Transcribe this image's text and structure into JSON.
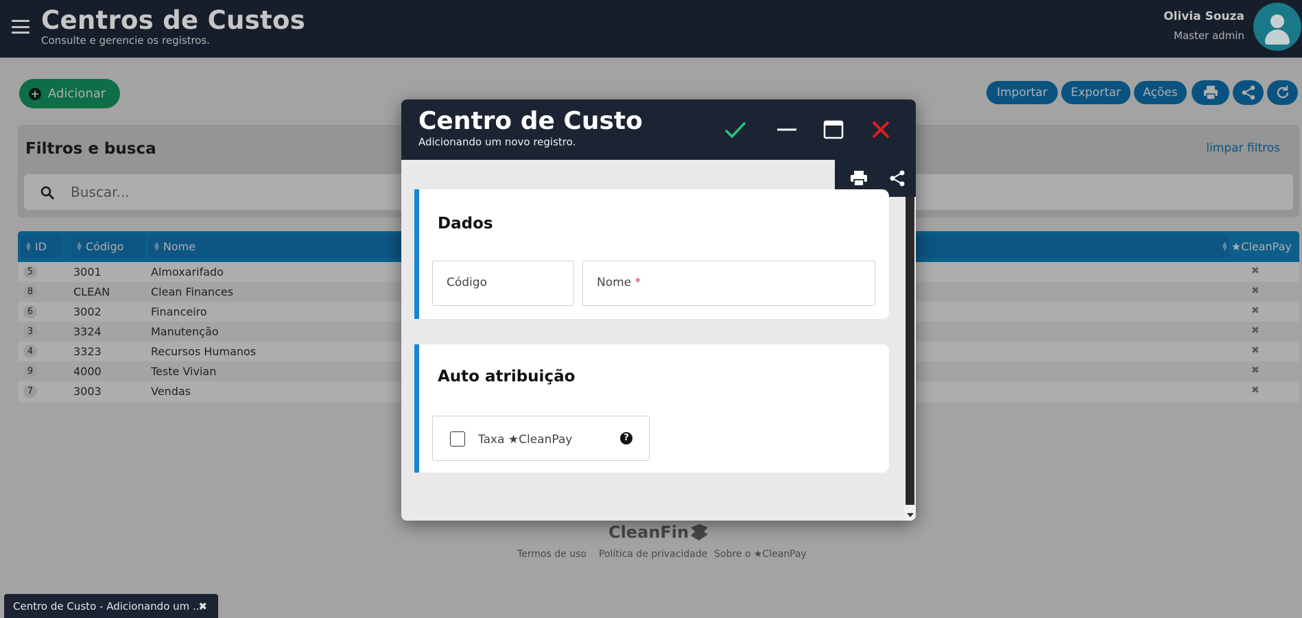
{
  "header": {
    "title": "Centros de Custos",
    "subtitle": "Consulte e gerencie os registros.",
    "user_name": "Olivia Souza",
    "user_role": "Master admin"
  },
  "toolbar": {
    "add_label": "Adicionar",
    "import_label": "Importar",
    "export_label": "Exportar",
    "actions_label": "Ações"
  },
  "filters": {
    "title": "Filtros e busca",
    "clear_label": "limpar filtros",
    "search_placeholder": "Buscar..."
  },
  "table": {
    "columns": [
      "ID",
      "Código",
      "Nome",
      "★CleanPay"
    ],
    "rows": [
      {
        "id": "5",
        "code": "3001",
        "name": "Almoxarifado",
        "cleanpay": "✖"
      },
      {
        "id": "8",
        "code": "CLEAN",
        "name": "Clean Finances",
        "cleanpay": "✖"
      },
      {
        "id": "6",
        "code": "3002",
        "name": "Financeiro",
        "cleanpay": "✖"
      },
      {
        "id": "3",
        "code": "3324",
        "name": "Manutenção",
        "cleanpay": "✖"
      },
      {
        "id": "4",
        "code": "3323",
        "name": "Recursos Humanos",
        "cleanpay": "✖"
      },
      {
        "id": "9",
        "code": "4000",
        "name": "Teste Vivian",
        "cleanpay": "✖"
      },
      {
        "id": "7",
        "code": "3003",
        "name": "Vendas",
        "cleanpay": "✖"
      }
    ]
  },
  "footer": {
    "logo": "CleanFin",
    "links": [
      "Termos de uso",
      "Política de privacidade",
      "Sobre o ★CleanPay"
    ]
  },
  "taskbar": {
    "label": "Centro de Custo - Adicionando um ...",
    "close": "✖"
  },
  "modal": {
    "title": "Centro de Custo",
    "subtitle": "Adicionando um novo registro.",
    "section_dados": {
      "title": "Dados",
      "codigo_label": "Código",
      "nome_label": "Nome",
      "required_mark": "*"
    },
    "section_auto": {
      "title": "Auto atribuição",
      "checkbox_label": "Taxa ★CleanPay",
      "help": "?"
    }
  },
  "colors": {
    "dark_navy": "#1c2433",
    "primary_blue": "#0f7bbf",
    "add_green": "#16a36a",
    "accent_border": "#1487cf",
    "confirm_green": "#22c47a",
    "close_red": "#e01f1f"
  },
  "icons": [
    "menu-icon",
    "user-icon",
    "plus-icon",
    "print-icon",
    "share-icon",
    "refresh-icon",
    "search-icon",
    "check-icon",
    "minimize-icon",
    "maximize-icon",
    "close-icon",
    "help-icon"
  ]
}
